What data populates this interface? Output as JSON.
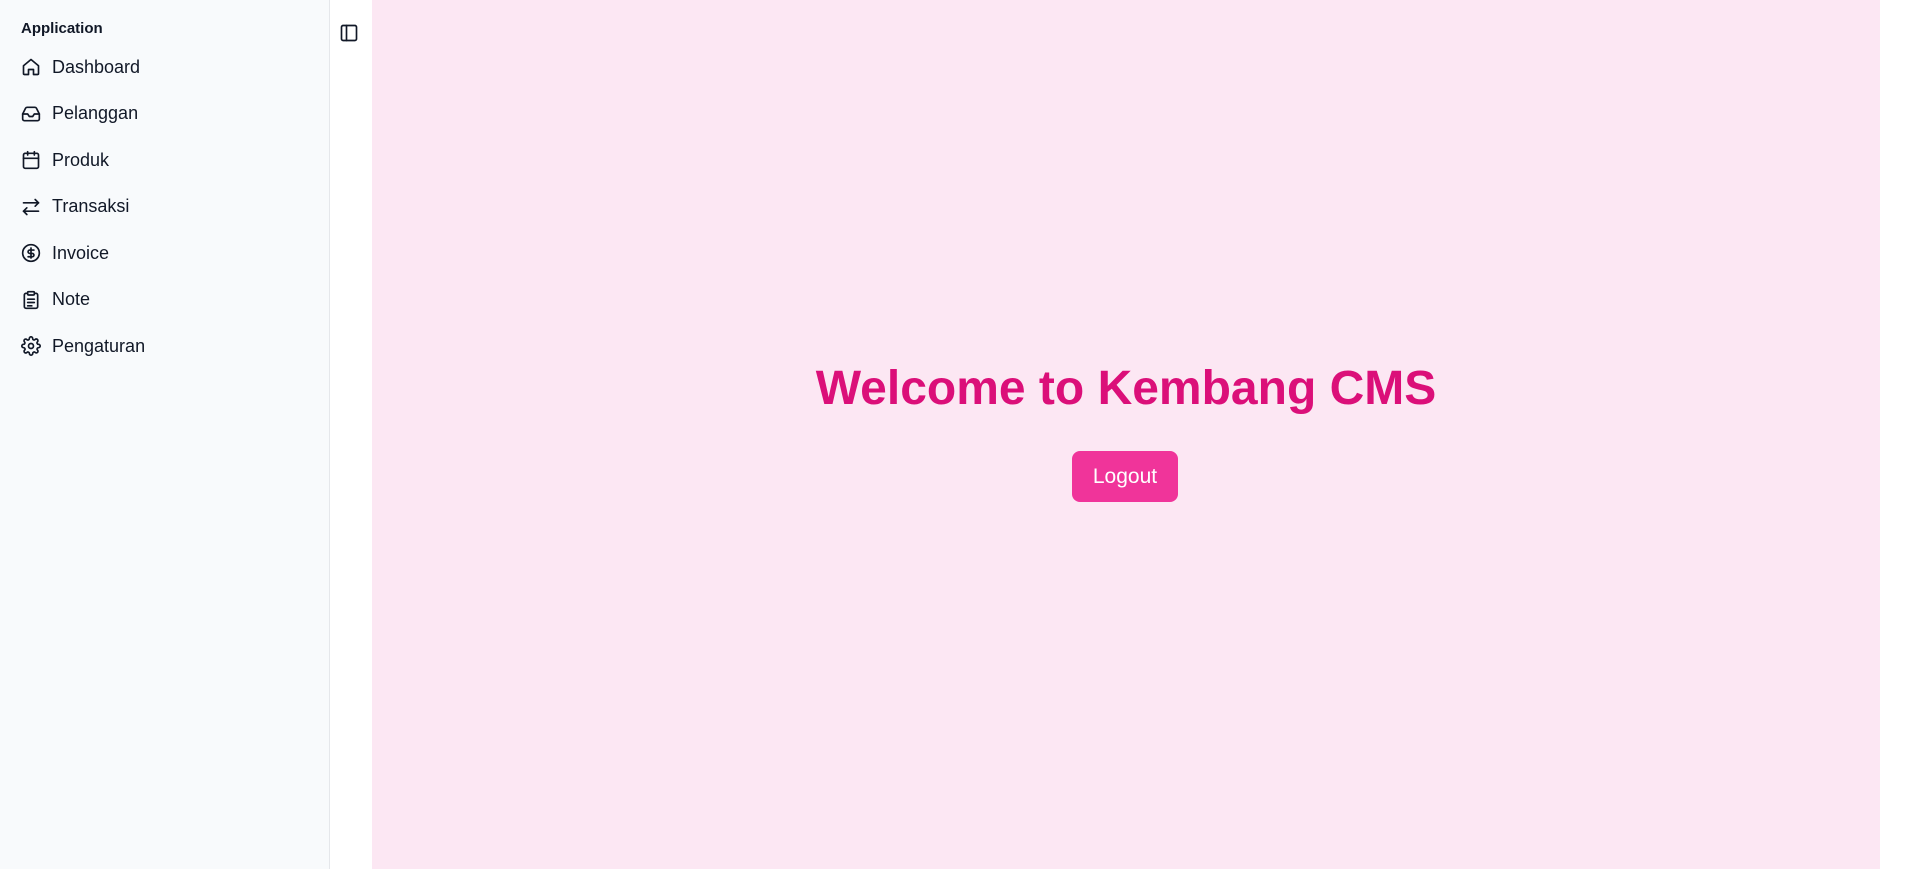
{
  "sidebar": {
    "group_label": "Application",
    "items": [
      {
        "label": "Dashboard",
        "icon": "home-icon"
      },
      {
        "label": "Pelanggan",
        "icon": "inbox-icon"
      },
      {
        "label": "Produk",
        "icon": "calendar-icon"
      },
      {
        "label": "Transaksi",
        "icon": "arrows-swap-icon"
      },
      {
        "label": "Invoice",
        "icon": "dollar-circle-icon"
      },
      {
        "label": "Note",
        "icon": "clipboard-icon"
      },
      {
        "label": "Pengaturan",
        "icon": "gear-icon"
      }
    ]
  },
  "header": {
    "toggle_icon": "sidebar-toggle-icon"
  },
  "main": {
    "title": "Welcome to Kembang CMS",
    "logout_label": "Logout"
  },
  "colors": {
    "sidebar_bg": "#f8fafc",
    "main_bg": "#fce7f3",
    "title": "#db0f79",
    "button_bg": "#f0349a",
    "button_text": "#ffffff"
  }
}
